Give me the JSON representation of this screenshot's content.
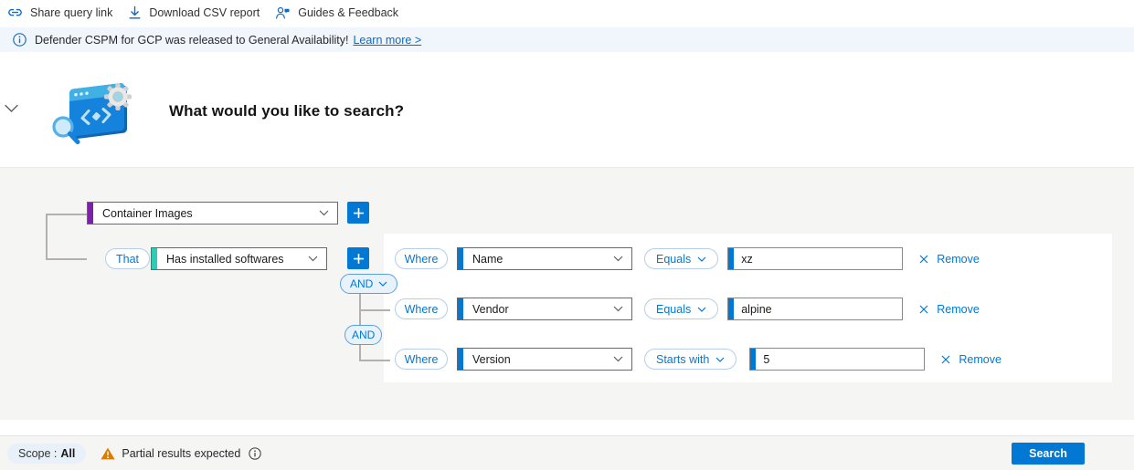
{
  "toolbar": {
    "items": [
      {
        "label": "Share query link",
        "icon": "link-icon"
      },
      {
        "label": "Download CSV report",
        "icon": "download-icon"
      },
      {
        "label": "Guides & Feedback",
        "icon": "feedback-icon"
      }
    ]
  },
  "banner": {
    "message": "Defender CSPM for GCP was released to General Availability!",
    "link_label": "Learn more >"
  },
  "header": {
    "title": "What would you like to search?"
  },
  "query": {
    "entity_select": {
      "value": "Container Images",
      "accent_color": "#7d22a8"
    },
    "that_label": "That",
    "relation_select": {
      "value": "Has installed softwares",
      "accent_color": "#2dccb4"
    },
    "and_label": "AND",
    "conditions": [
      {
        "where": "Where",
        "field": "Name",
        "operator": "Equals",
        "value": "xz",
        "remove": "Remove"
      },
      {
        "where": "Where",
        "field": "Vendor",
        "operator": "Equals",
        "value": "alpine",
        "remove": "Remove"
      },
      {
        "where": "Where",
        "field": "Version",
        "operator": "Starts with",
        "value": "5",
        "remove": "Remove"
      }
    ]
  },
  "footer": {
    "scope_label": "Scope :",
    "scope_value": "All",
    "warning": "Partial results expected",
    "search_label": "Search"
  },
  "colors": {
    "accent_blue": "#0078d4",
    "accent_purple": "#7d22a8",
    "accent_teal": "#2dccb4",
    "warning_orange": "#db7c00",
    "banner_bg": "#f0f6fc",
    "panel_bg": "#f5f5f4"
  }
}
